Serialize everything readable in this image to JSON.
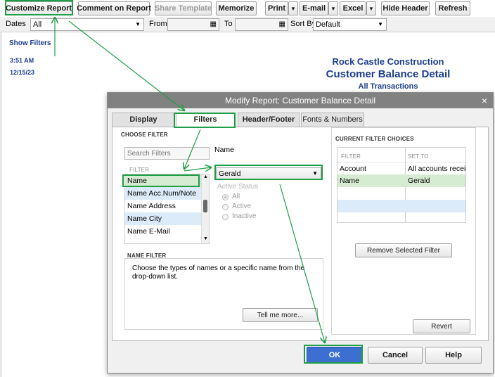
{
  "toolbar": {
    "customize_report": "Customize Report",
    "comment_on_report": "Comment on Report",
    "share_template": "Share Template",
    "memorize": "Memorize",
    "print": "Print",
    "email": "E-mail",
    "excel": "Excel",
    "hide_header": "Hide Header",
    "refresh": "Refresh"
  },
  "filterbar": {
    "dates_label": "Dates",
    "dates_value": "All",
    "from_label": "From",
    "from_value": "",
    "to_label": "To",
    "to_value": "",
    "sortby_label": "Sort By",
    "sortby_value": "Default"
  },
  "report": {
    "show_filters": "Show Filters",
    "time": "3:51 AM",
    "date": "12/15/23",
    "company": "Rock Castle Construction",
    "title": "Customer Balance Detail",
    "subtitle": "All Transactions"
  },
  "dialog": {
    "title": "Modify Report: Customer Balance Detail",
    "close": "×",
    "tabs": [
      "Display",
      "Filters",
      "Header/Footer",
      "Fonts & Numbers"
    ],
    "choose_filter_header": "CHOOSE FILTER",
    "search_placeholder": "Search Filters",
    "filter_col_header": "FILTER",
    "filter_items": [
      "Name",
      "Name Acc.Num/Note",
      "Name Address",
      "Name City",
      "Name E-Mail"
    ],
    "name_label": "Name",
    "name_value": "Gerald",
    "active_status_label": "Active Status",
    "radio_all": "All",
    "radio_active": "Active",
    "radio_inactive": "Inactive",
    "name_filter_header": "NAME FILTER",
    "name_filter_desc": "Choose the types of names or a specific name from the drop-down list.",
    "tell_me_more": "Tell me more...",
    "current_filter_header": "CURRENT FILTER CHOICES",
    "current_filter_col": "FILTER",
    "current_setto_col": "SET TO",
    "current_rows": [
      {
        "filter": "Account",
        "set_to": "All accounts recei..."
      },
      {
        "filter": "Name",
        "set_to": "Gerald"
      }
    ],
    "remove_selected": "Remove Selected Filter",
    "revert": "Revert",
    "ok": "OK",
    "cancel": "Cancel",
    "help": "Help"
  },
  "colors": {
    "annotation_green": "#1e9e45",
    "report_blue": "#1b3d8f",
    "ok_blue": "#3c6fd0",
    "selected_green": "#d6ecd2",
    "selected_blue": "#dcebfa"
  }
}
